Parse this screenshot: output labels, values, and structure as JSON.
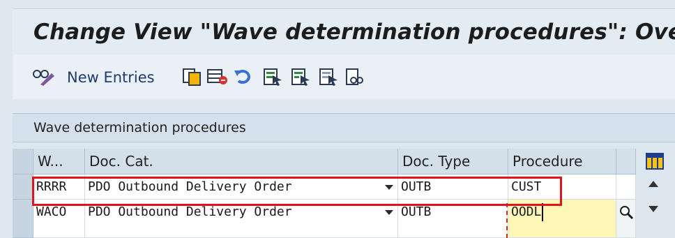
{
  "window": {
    "title": "Change View \"Wave determination procedures\": Ove"
  },
  "toolbar": {
    "new_entries_label": "New Entries",
    "icons": [
      "display-change-icon",
      "copy-icon",
      "delete-icon",
      "undo-icon",
      "select-all-icon",
      "select-block-icon",
      "deselect-all-icon",
      "find-icon"
    ]
  },
  "panel": {
    "title": "Wave determination procedures"
  },
  "table": {
    "headers": {
      "w": "W...",
      "doc_cat": "Doc. Cat.",
      "doc_type": "Doc. Type",
      "procedure": "Procedure"
    },
    "rows": [
      {
        "w": "RRRR",
        "doc_cat": "PDO Outbound Delivery Order",
        "doc_type": "OUTB",
        "procedure": "CUST"
      },
      {
        "w": "WACO",
        "doc_cat": "PDO Outbound Delivery Order",
        "doc_type": "OUTB",
        "procedure": "OODL"
      }
    ]
  },
  "colors": {
    "highlight": "#e0141f",
    "active_field": "#fff7b8",
    "title_text": "#1c1c1c",
    "link_text": "#1f3a6d"
  }
}
